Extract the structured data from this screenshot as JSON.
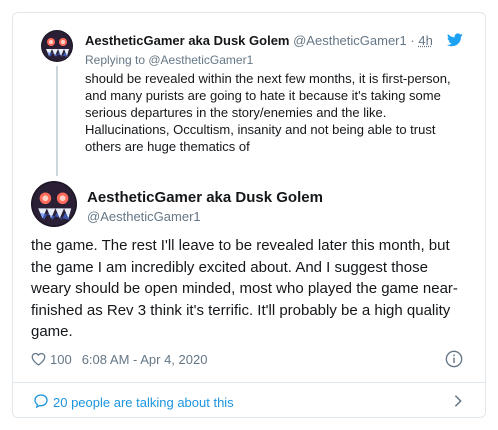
{
  "parent_tweet": {
    "display_name": "AestheticGamer aka Dusk Golem",
    "handle": "@AestheticGamer1",
    "separator": "·",
    "time": "4h",
    "replying_to": "Replying to @AestheticGamer1",
    "text": "should be revealed within the next few months, it is first-person, and many purists are going to hate it because it's taking some serious departures in the story/enemies and the like. Hallucinations, Occultism, insanity and  not being able to trust others are huge thematics of"
  },
  "main_tweet": {
    "display_name": "AestheticGamer aka Dusk Golem",
    "handle": "@AestheticGamer1",
    "text": "the game. The rest I'll leave to be revealed later this month, but the game I am incredibly excited about. And I suggest those weary should be open minded, most who played the game near-finished as Rev 3 think it's terrific. It'll probably be a high quality game.",
    "likes": "100",
    "timestamp": "6:08 AM - Apr 4, 2020"
  },
  "footer": {
    "talking_label": "20 people are talking about this"
  },
  "icons": {
    "brand": "twitter-bird-icon",
    "like": "heart-icon",
    "info": "info-icon",
    "talking": "speech-bubble-icon",
    "more": "chevron-right-icon"
  },
  "colors": {
    "link": "#1b95e0",
    "secondary_text": "#657786",
    "border": "#e1e8ed",
    "avatar_bg": "#1a1422"
  }
}
